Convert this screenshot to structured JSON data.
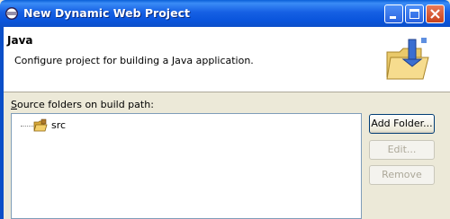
{
  "window": {
    "title": "New Dynamic Web Project",
    "controls": {
      "minimize": "minimize-icon",
      "maximize": "maximize-icon",
      "close": "close-icon"
    }
  },
  "header": {
    "title": "Java",
    "description": "Configure project for building a Java application.",
    "icon": "java-project-folder-icon"
  },
  "source_section": {
    "label_accel": "S",
    "label_rest": "ource folders on build path:",
    "items": [
      {
        "label": "src",
        "icon": "package-folder-icon"
      }
    ]
  },
  "buttons": {
    "add_folder": {
      "label": "Add Folder...",
      "enabled": true
    },
    "edit": {
      "label": "Edit...",
      "enabled": false
    },
    "remove": {
      "label": "Remove",
      "enabled": false
    }
  },
  "colors": {
    "titlebar": "#0a55dc",
    "dialog_bg": "#ece9d8",
    "panel_border": "#7f9db9"
  }
}
